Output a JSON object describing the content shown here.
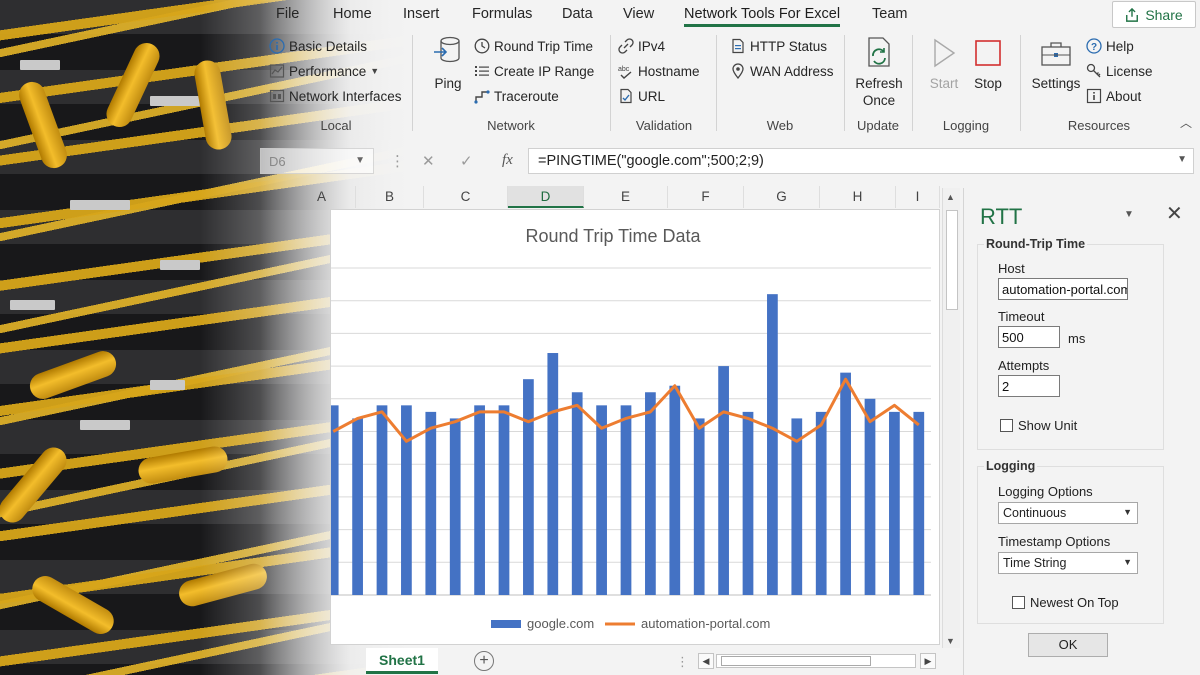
{
  "menu": {
    "tabs": [
      "File",
      "Home",
      "Insert",
      "Formulas",
      "Data",
      "View",
      "Network Tools For Excel",
      "Team"
    ],
    "active_tab": "Network Tools For Excel",
    "share_label": "Share"
  },
  "ribbon": {
    "local": {
      "label": "Local",
      "basic_details": "Basic Details",
      "performance": "Performance",
      "network_interfaces": "Network Interfaces"
    },
    "network": {
      "label": "Network",
      "ping": "Ping",
      "round_trip_time": "Round Trip Time",
      "create_ip_range": "Create IP Range",
      "traceroute": "Traceroute"
    },
    "validation": {
      "label": "Validation",
      "ipv4": "IPv4",
      "hostname": "Hostname",
      "url": "URL"
    },
    "web": {
      "label": "Web",
      "http_status": "HTTP Status",
      "wan_address": "WAN Address"
    },
    "update": {
      "label": "Update",
      "refresh_once_line1": "Refresh",
      "refresh_once_line2": "Once"
    },
    "logging": {
      "label": "Logging",
      "start": "Start",
      "stop": "Stop"
    },
    "resources": {
      "label": "Resources",
      "settings": "Settings",
      "help": "Help",
      "license": "License",
      "about": "About"
    }
  },
  "formula_bar": {
    "name_box": "D6",
    "formula": "=PINGTIME(\"google.com\";500;2;9)"
  },
  "columns": [
    "A",
    "B",
    "C",
    "D",
    "E",
    "F",
    "G",
    "H",
    "I"
  ],
  "active_column": "D",
  "sheet": {
    "tab": "Sheet1"
  },
  "chart_data": {
    "type": "bar",
    "title": "Round Trip Time Data",
    "ylim": [
      0,
      50
    ],
    "y_ticks": [
      50,
      45,
      40,
      35,
      30
    ],
    "grid": true,
    "legend": "bottom",
    "series": [
      {
        "name": "google.com",
        "type": "bar",
        "color": "#4472C4",
        "values": [
          29,
          27,
          29,
          29,
          28,
          27,
          29,
          29,
          33,
          37,
          31,
          29,
          29,
          31,
          32,
          27,
          35,
          28,
          46,
          27,
          28,
          34,
          30,
          28,
          28
        ]
      },
      {
        "name": "automation-portal.com",
        "type": "line",
        "color": "#ED7D31",
        "values": [
          25,
          27,
          28,
          23.5,
          25.5,
          26.5,
          28,
          28,
          26.5,
          28,
          29,
          25.5,
          27,
          28,
          32,
          25.5,
          28,
          27,
          25.5,
          23.5,
          26,
          33,
          26.5,
          29,
          26
        ]
      }
    ]
  },
  "pane": {
    "title": "RTT",
    "rtt_section": "Round-Trip Time",
    "host_label": "Host",
    "host_value": "automation-portal.com",
    "timeout_label": "Timeout",
    "timeout_value": "500",
    "timeout_unit": "ms",
    "attempts_label": "Attempts",
    "attempts_value": "2",
    "show_unit": "Show Unit",
    "logging_section": "Logging",
    "logging_options_label": "Logging Options",
    "logging_options_value": "Continuous",
    "timestamp_options_label": "Timestamp Options",
    "timestamp_options_value": "Time String",
    "newest_on_top": "Newest On Top",
    "ok": "OK"
  }
}
